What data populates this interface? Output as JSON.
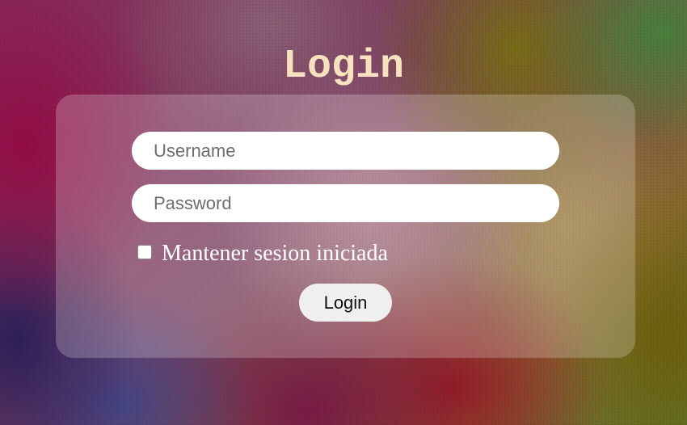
{
  "page": {
    "title": "Login"
  },
  "form": {
    "username_placeholder": "Username",
    "username_value": "",
    "password_placeholder": "Password",
    "password_value": "",
    "remember_label": "Mantener sesion iniciada",
    "remember_checked": false,
    "submit_label": "Login"
  },
  "colors": {
    "title": "#f7e2c0",
    "panel": "rgba(255,255,255,0.22)",
    "input_background": "#ffffff",
    "button_background": "#efefef"
  }
}
